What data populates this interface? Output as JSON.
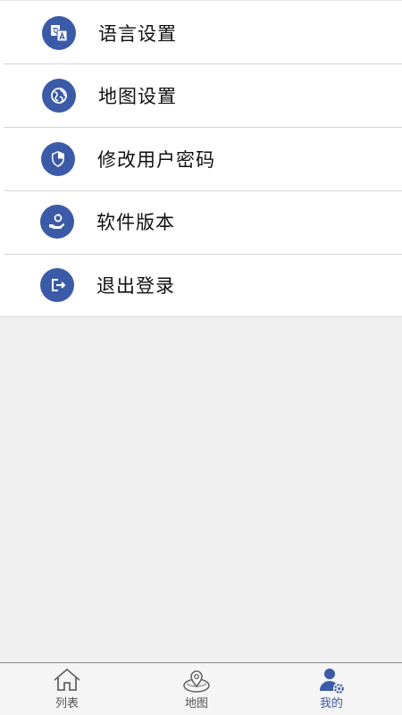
{
  "menu": {
    "items": [
      {
        "label": "语言设置",
        "icon": "language-icon"
      },
      {
        "label": "地图设置",
        "icon": "globe-icon"
      },
      {
        "label": "修改用户密码",
        "icon": "shield-icon"
      },
      {
        "label": "软件版本",
        "icon": "version-hand-icon"
      },
      {
        "label": "退出登录",
        "icon": "logout-icon"
      }
    ]
  },
  "tabbar": {
    "tabs": [
      {
        "label": "列表",
        "icon": "home-icon"
      },
      {
        "label": "地图",
        "icon": "map-icon"
      },
      {
        "label": "我的",
        "icon": "user-settings-icon"
      }
    ],
    "active_tab": "我的"
  },
  "colors": {
    "accent": "#3b5ba8",
    "background": "#f0f0f0",
    "inactive_tab": "#555555"
  }
}
